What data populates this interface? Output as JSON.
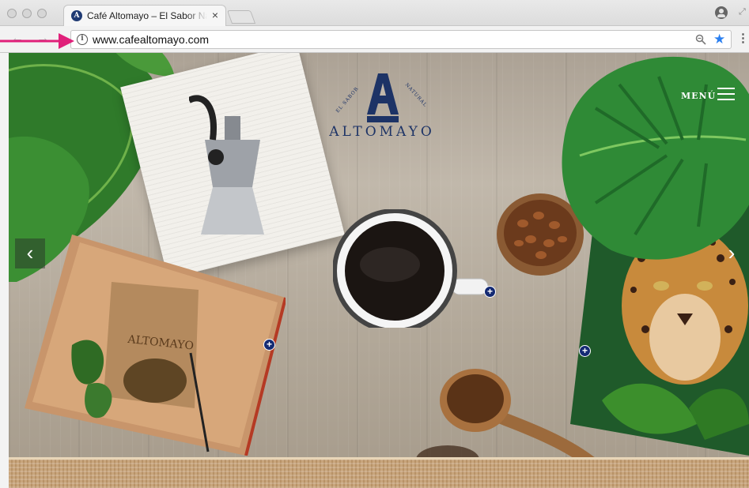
{
  "browser": {
    "tab": {
      "title": "Café Altomayo – El Sabor Natural",
      "close_glyph": "×",
      "favicon_letter": "A"
    },
    "url": "www.cafealtomayo.com",
    "info_glyph": "i",
    "icons": {
      "back": "back-arrow-icon",
      "forward": "forward-arrow-icon",
      "zoom": "zoom-icon",
      "bookmark": "star-icon",
      "menu": "more-vert-icon",
      "profile": "profile-icon"
    },
    "star_color": "#2a7ff0"
  },
  "annotation": {
    "arrow_color": "#e0207a"
  },
  "site": {
    "logo": {
      "word": "ALTOMAYO",
      "arc_left": "EL SABOR",
      "arc_right": "NATURAL",
      "brand_color": "#1d3366"
    },
    "menu_label": "MENÚ",
    "carousel": {
      "prev_glyph": "‹",
      "next_glyph": "›"
    },
    "hotspots": [
      "+",
      "+",
      "+"
    ],
    "hotspot_color": "#142a73"
  }
}
